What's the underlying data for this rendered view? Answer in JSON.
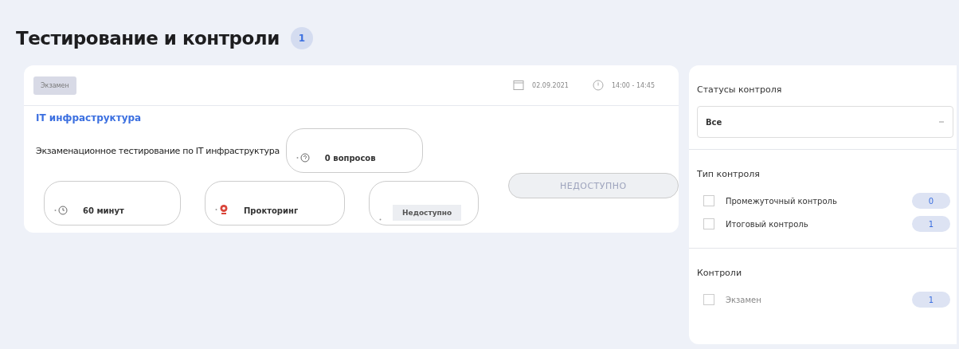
{
  "page": {
    "title": "Тестирование и контроли",
    "count": "1"
  },
  "card": {
    "tag": "Экзамен",
    "date": "02.09.2021",
    "time": "14:00 - 14:45",
    "subject": "IT инфраструктура",
    "description": "Экзаменационное тестирование по IT инфраструктура",
    "chips": [
      {
        "kind": "questions",
        "text": "0 вопросов"
      },
      {
        "kind": "duration",
        "text": "60 минут"
      },
      {
        "kind": "proctoring",
        "text": "Прокторинг"
      },
      {
        "kind": "status",
        "text": "Недоступно"
      }
    ],
    "button": {
      "label": "НЕДОСТУПНО",
      "disabled": true
    }
  },
  "filters": {
    "status": {
      "title": "Статусы контроля",
      "value": "Все"
    },
    "groups": [
      {
        "title": "Тип контроля",
        "items": [
          {
            "label": "Промежуточный контроль",
            "count": "0",
            "checked": false
          },
          {
            "label": "Итоговый контроль",
            "count": "1",
            "checked": false
          }
        ]
      },
      {
        "title": "Контроли",
        "items": [
          {
            "label": "Экзамен",
            "count": "1",
            "checked": false
          }
        ]
      }
    ]
  }
}
